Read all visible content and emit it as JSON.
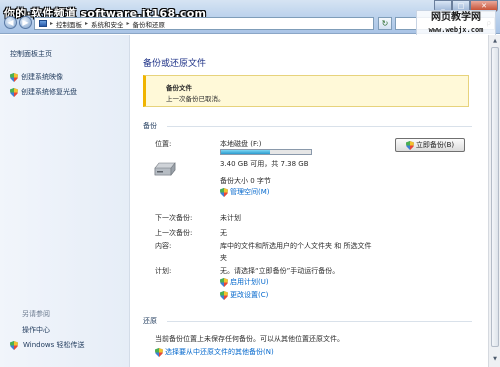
{
  "watermark": {
    "left_text": "你的·软件频道 software.it168.com",
    "right_line1": "网页教学网",
    "right_line2": "www.webjx.com"
  },
  "address_bar": {
    "crumbs": [
      "控制面板",
      "系统和安全",
      "备份和还原"
    ],
    "search_text": "ρ"
  },
  "sidebar": {
    "home_link": "控制面板主页",
    "items": [
      {
        "label": "创建系统映像",
        "icon": "shield-icon"
      },
      {
        "label": "创建系统修复光盘",
        "icon": "shield-icon"
      }
    ],
    "see_also_title": "另请参阅",
    "see_also_items": [
      {
        "label": "操作中心"
      },
      {
        "label": "Windows 轻松传送",
        "icon": "shield-icon"
      }
    ]
  },
  "main": {
    "title": "备份或还原文件",
    "notice": {
      "title": "备份文件",
      "text": "上一次备份已取消。"
    },
    "backup_section": {
      "heading": "备份",
      "location_label": "位置:",
      "drive_name": "本地磁盘 (F:)",
      "capacity_text": "3.40 GB 可用，共 7.38 GB",
      "used_fraction": 0.54,
      "backup_size": "备份大小 0 字节",
      "manage_space_link": "管理空间(M)",
      "backup_now_button": "立即备份(B)",
      "next_backup_label": "下一次备份:",
      "next_backup_value": "未计划",
      "last_backup_label": "上一次备份:",
      "last_backup_value": "无",
      "contents_label": "内容:",
      "contents_value_line1": "库中的文件和所选用户的个人文件夹 和 所选文件",
      "contents_value_line2": "夹",
      "schedule_label": "计划:",
      "schedule_value": "无。请选择“立即备份”手动运行备份。",
      "enable_schedule_link": "启用计划(U)",
      "change_settings_link": "更改设置(C)"
    },
    "restore_section": {
      "heading": "还原",
      "text": "当前备份位置上未保存任何备份。可以从其他位置还原文件。",
      "select_backup_link": "选择要从中还原文件的其他备份(N)"
    }
  },
  "colors": {
    "link": "#0066cc",
    "title_blue": "#1e3287",
    "notice_bg": "#fff9d8",
    "notice_accent": "#f0b400",
    "progress_fill": "#2a9bcf"
  }
}
